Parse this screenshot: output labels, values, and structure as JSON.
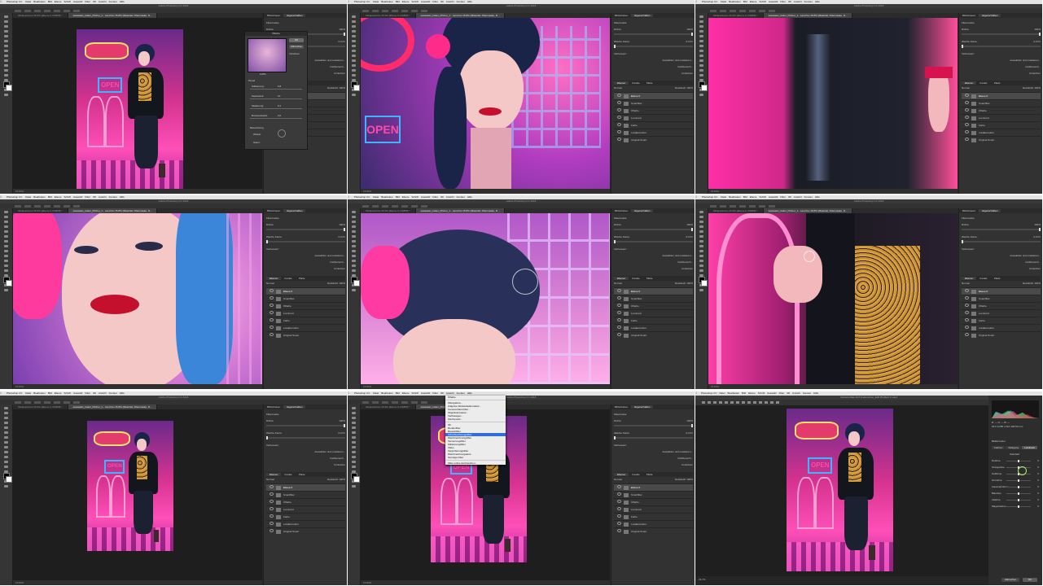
{
  "menubar": {
    "app": "Photoshop CC",
    "items": [
      "Datei",
      "Bearbeiten",
      "Bild",
      "Ebene",
      "Schrift",
      "Auswahl",
      "Filter",
      "3D",
      "Ansicht",
      "Fenster",
      "Hilfe"
    ]
  },
  "window_title": "Adobe Photoshop CC 2018",
  "doc_tabs": [
    "Klickpunkt bei 15.2% (Ebene 0, RGB/8) *",
    "sasasasis_baker_Pitcher_1 - Land bei 15.8% (Materiali, Filtermaske, R..."
  ],
  "canvas_status": "15.84%",
  "panels": {
    "tabs": [
      "Bibliotheken",
      "Eigenschaften"
    ],
    "property_heading": "Filtermaske",
    "density_label": "Dichte:",
    "density_value": "100%",
    "feather_label": "Weiche Kante:",
    "feather_value": "0,0 Px",
    "refine_label": "Verbessern:",
    "select_mask_button": "Auswählen und maskieren...",
    "color_range_button": "Farbbereich...",
    "invert_button": "Umkehren",
    "layers_tabs": [
      "Ebenen",
      "Kanäle",
      "Pfade"
    ],
    "blend_mode": "Normal",
    "opacity_label": "Deckkraft:",
    "opacity_value": "100%",
    "layers": [
      "Ebene 0",
      "Smartfilter",
      "Ölfarbe",
      "Luminanz",
      "Farbe",
      "Lokalkorrektur",
      "Original Smart"
    ]
  },
  "oil_dialog": {
    "title": "Ölfarbe",
    "ok": "OK",
    "cancel": "Abbrechen",
    "preview": "Vorschau",
    "zoom": "100%",
    "brush_heading": "Pinsel",
    "stylization": "Stilisierung:",
    "stylization_value": "6,8",
    "cleanliness": "Sauberkeit:",
    "cleanliness_value": "10",
    "scale": "Skalierung:",
    "scale_value": "0,1",
    "bristle": "Borstendetails:",
    "bristle_value": "0,0",
    "lighting_heading": "Beleuchtung",
    "angle": "Winkel:",
    "shine": "Glanz:"
  },
  "filter_menu": {
    "items": [
      "Ölfarbe",
      "Filtergalerie...",
      "Adaptive Weitwinkelkorrektur...",
      "Camera Raw-Filter...",
      "Objektivkorrektur...",
      "Verflüssigen...",
      "Fluchtpunkt...",
      "3D",
      "Renderfilter",
      "Rauschfilter",
      "Scharfzeichnungsfilter",
      "Weichzeichnungsfilter",
      "Verzerrungsfilter",
      "Stilisierungsfilter",
      "Video",
      "Vergröberungsfilter",
      "Weichzeichnergalerie",
      "Sonstige Filter",
      "Filter online durchsuchen..."
    ],
    "highlighted_index": 10
  },
  "camera_raw": {
    "title": "Camera Raw 10.0 (Lebensmut_Edit 35.Werk 1 Land",
    "readout": "R: ---  G: ---  B: ---",
    "readout2": "f/4.0  1/250 s   ISO 100  50 mm",
    "section": "Bildkorrektur",
    "tabs": [
      "Farbton",
      "Sättigung",
      "Luminanz"
    ],
    "default_label": "Standard",
    "sliders": [
      {
        "name": "Rottöne",
        "value": "0"
      },
      {
        "name": "Orangetöne",
        "value": "0"
      },
      {
        "name": "Gelbtöne",
        "value": "0"
      },
      {
        "name": "Grüntöne",
        "value": "0"
      },
      {
        "name": "Aquamarintöne",
        "value": "0"
      },
      {
        "name": "Blautöne",
        "value": "0"
      },
      {
        "name": "Lilatöne",
        "value": "0"
      },
      {
        "name": "Magentatöne",
        "value": "0"
      }
    ],
    "cancel": "Abbrechen",
    "ok": "OK",
    "zoom": "15,7%"
  },
  "neon_sign_text": "OPEN",
  "colors": {
    "app_bg": "#282828",
    "panel_bg": "#323232",
    "neon_pink": "#ff2fa6",
    "neon_blue": "#3fb5ff",
    "menu_highlight": "#2f6fdc"
  }
}
